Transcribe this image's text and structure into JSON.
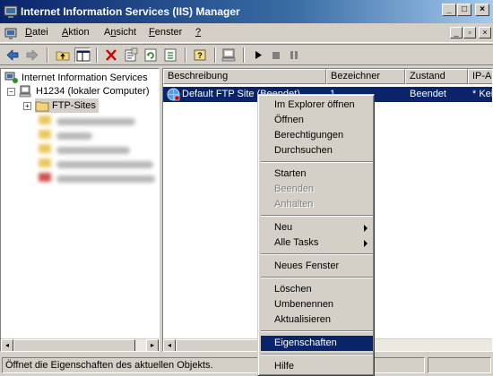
{
  "window": {
    "title": "Internet Information Services (IIS) Manager",
    "minimize_glyph": "_",
    "maximize_glyph": "□",
    "close_glyph": "×"
  },
  "menubar": {
    "items": [
      {
        "label": "Datei",
        "accel": "D",
        "rest": "atei"
      },
      {
        "label": "Aktion",
        "accel": "A",
        "rest": "ktion"
      },
      {
        "label": "Ansicht",
        "pre": "A",
        "accel": "n",
        "rest": "sicht"
      },
      {
        "label": "Fenster",
        "accel": "F",
        "rest": "enster"
      },
      {
        "label": "?",
        "accel": "?",
        "rest": ""
      }
    ],
    "mdi_minimize": "_",
    "mdi_restore": "▫",
    "mdi_close": "×"
  },
  "toolbar": {
    "icons": [
      "back-icon",
      "forward-icon",
      "up-folder-icon",
      "show-hide-tree-icon",
      "delete-icon",
      "properties-icon",
      "refresh-icon",
      "export-list-icon",
      "help-icon",
      "computer-icon",
      "start-icon",
      "stop-icon",
      "pause-icon"
    ]
  },
  "tree": {
    "root": "Internet Information Services",
    "computer": "H1234 (lokaler Computer)",
    "ftp_sites": "FTP-Sites",
    "expander_minus": "−",
    "expander_plus": "+"
  },
  "list": {
    "columns": [
      "Beschreibung",
      "Bezeichner",
      "Zustand",
      "IP-Ad"
    ],
    "rows": [
      {
        "description": "Default FTP Site (Beendet)",
        "id": "1",
        "state": "Beendet",
        "ip": "* Kei"
      }
    ]
  },
  "context_menu": {
    "items": [
      {
        "label": "Im Explorer öffnen",
        "enabled": true
      },
      {
        "label": "Öffnen",
        "enabled": true
      },
      {
        "label": "Berechtigungen",
        "enabled": true
      },
      {
        "label": "Durchsuchen",
        "enabled": true
      },
      {
        "label": "Starten",
        "enabled": true
      },
      {
        "label": "Beenden",
        "enabled": false
      },
      {
        "label": "Anhalten",
        "enabled": false
      },
      {
        "label": "Neu",
        "enabled": true,
        "submenu": true
      },
      {
        "label": "Alle Tasks",
        "enabled": true,
        "submenu": true
      },
      {
        "label": "Neues Fenster",
        "enabled": true
      },
      {
        "label": "Löschen",
        "enabled": true
      },
      {
        "label": "Umbenennen",
        "enabled": true
      },
      {
        "label": "Aktualisieren",
        "enabled": true
      },
      {
        "label": "Eigenschaften",
        "enabled": true,
        "highlighted": true
      },
      {
        "label": "Hilfe",
        "enabled": true
      }
    ]
  },
  "statusbar": {
    "text": "Öffnet die Eigenschaften des aktuellen Objekts."
  },
  "colors": {
    "selection": "#0a246a",
    "face": "#d4d0c8"
  }
}
